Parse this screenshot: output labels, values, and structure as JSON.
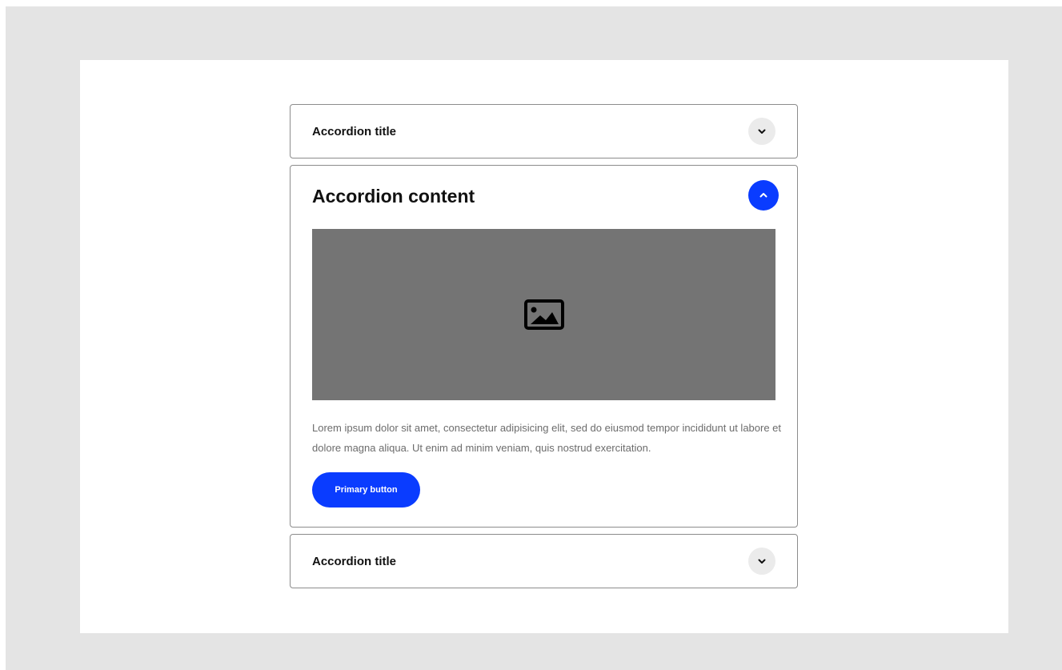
{
  "accordion": {
    "items": [
      {
        "title": "Accordion title",
        "state": "collapsed",
        "toggle_icon": "chevron-down-icon"
      },
      {
        "title": "Accordion content",
        "state": "expanded",
        "toggle_icon": "chevron-up-icon",
        "media_icon": "image-placeholder-icon",
        "body": "Lorem ipsum dolor sit amet, consectetur adipisicing elit, sed do eiusmod tempor incididunt ut labore et dolore magna aliqua. Ut enim ad minim veniam, quis nostrud exercitation.",
        "button_label": "Primary button"
      },
      {
        "title": "Accordion title",
        "state": "collapsed",
        "toggle_icon": "chevron-down-icon"
      }
    ]
  },
  "colors": {
    "accent": "#0a3cff",
    "backdrop": "#e4e4e4",
    "media_placeholder": "#747474",
    "toggle_inactive": "#ebebeb",
    "border": "#8c8c8c"
  }
}
